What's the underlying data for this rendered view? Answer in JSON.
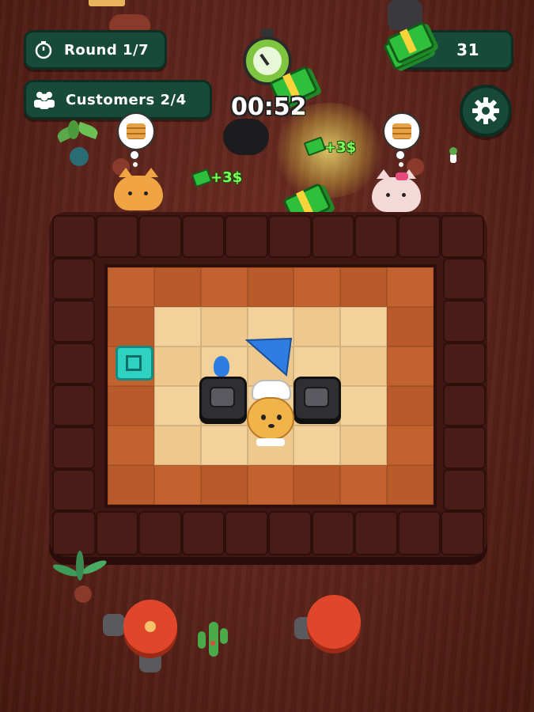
{
  "hud": {
    "round_label": "Round 1/7",
    "customers_label": "Customers 2/4",
    "money_value": "31",
    "timer_value": "00:52"
  },
  "rewards": {
    "left": "+3$",
    "right": "+3$"
  },
  "icons": {
    "round": "stopwatch-icon",
    "customers": "people-icon",
    "money": "cash-stack-icon",
    "settings": "gear-icon",
    "timer": "stopwatch-icon"
  },
  "colors": {
    "hud_bg": "#174a38",
    "reward_text": "#7dff5a",
    "cash": "#2fbf3a",
    "timer_green": "#7ec640"
  }
}
